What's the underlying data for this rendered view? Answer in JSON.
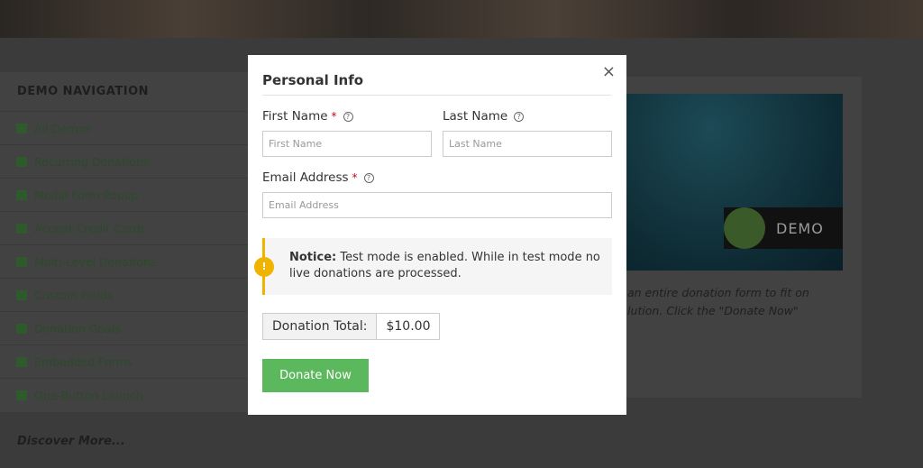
{
  "sidebar": {
    "title": "DEMO NAVIGATION",
    "items": [
      {
        "label": "All Demos",
        "icon": "grid-icon"
      },
      {
        "label": "Recurring Donations",
        "icon": "refresh-icon"
      },
      {
        "label": "Modal Form Popup",
        "icon": "window-icon"
      },
      {
        "label": "Accept Credit Cards",
        "icon": "credit-card-icon"
      },
      {
        "label": "Multi-Level Donations",
        "icon": "signal-icon"
      },
      {
        "label": "Custom Fields",
        "icon": "list-icon"
      },
      {
        "label": "Donation Goals",
        "icon": "flag-icon"
      },
      {
        "label": "Embedded Forms",
        "icon": "browser-icon"
      },
      {
        "label": "One-Button Launch",
        "icon": "edit-icon"
      }
    ],
    "discover": "Discover More..."
  },
  "content": {
    "badge": "DEMO",
    "description_line1": "an entire donation form to fit on",
    "description_line2": "lution. Click the \"Donate Now\""
  },
  "modal": {
    "title": "Personal Info",
    "close": "×",
    "first_name": {
      "label": "First Name",
      "required": "*",
      "placeholder": "First Name"
    },
    "last_name": {
      "label": "Last Name",
      "placeholder": "Last Name"
    },
    "email": {
      "label": "Email Address",
      "required": "*",
      "placeholder": "Email Address"
    },
    "notice": {
      "strong": "Notice:",
      "text": " Test mode is enabled. While in test mode no live donations are processed."
    },
    "total_label": "Donation Total:",
    "total_value": "$10.00",
    "donate_label": "Donate Now"
  },
  "colors": {
    "accent": "#5cb85c",
    "warning": "#f0b400",
    "required": "#d0021b"
  }
}
